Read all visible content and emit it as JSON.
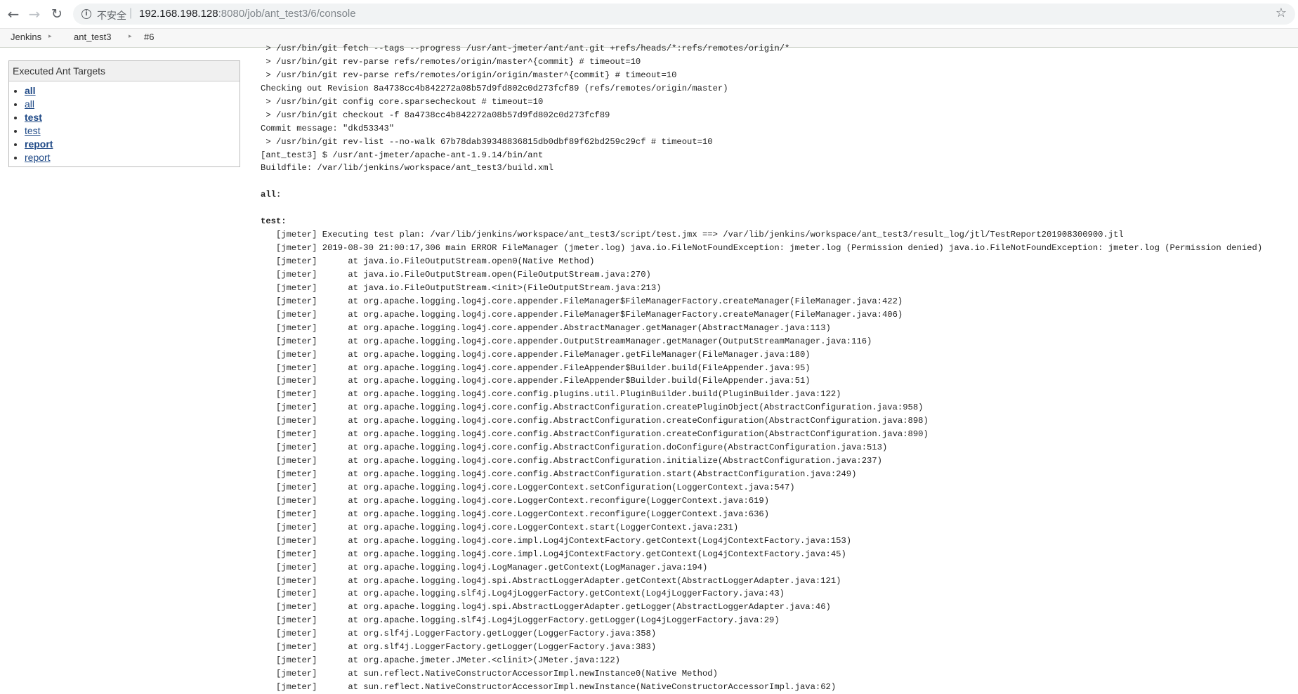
{
  "browser": {
    "back_icon": "←",
    "forward_icon": "→",
    "reload_icon": "↻",
    "info_icon": "i",
    "insecure_label": "不安全",
    "separator": "|",
    "url_host": "192.168.198.128",
    "url_rest": ":8080/job/ant_test3/6/console",
    "star_icon": "☆"
  },
  "breadcrumb": {
    "items": [
      "Jenkins",
      "ant_test3",
      "#6"
    ],
    "separator": "▸"
  },
  "panel": {
    "title": "Executed Ant Targets",
    "items": [
      {
        "label": "all",
        "bold": true
      },
      {
        "label": "all",
        "bold": false
      },
      {
        "label": "test",
        "bold": true
      },
      {
        "label": "test",
        "bold": false
      },
      {
        "label": "report",
        "bold": true
      },
      {
        "label": "report",
        "bold": false
      }
    ]
  },
  "console": {
    "lines": [
      " > /usr/bin/git fetch --tags --progress /usr/ant-jmeter/ant/ant.git +refs/heads/*:refs/remotes/origin/*",
      " > /usr/bin/git rev-parse refs/remotes/origin/master^{commit} # timeout=10",
      " > /usr/bin/git rev-parse refs/remotes/origin/origin/master^{commit} # timeout=10",
      "Checking out Revision 8a4738cc4b842272a08b57d9fd802c0d273fcf89 (refs/remotes/origin/master)",
      " > /usr/bin/git config core.sparsecheckout # timeout=10",
      " > /usr/bin/git checkout -f 8a4738cc4b842272a08b57d9fd802c0d273fcf89",
      "Commit message: \"dkd53343\"",
      " > /usr/bin/git rev-list --no-walk 67b78dab39348836815db0dbf89f62bd259c29cf # timeout=10",
      "[ant_test3] $ /usr/ant-jmeter/apache-ant-1.9.14/bin/ant",
      "Buildfile: /var/lib/jenkins/workspace/ant_test3/build.xml",
      "",
      "all:",
      "",
      "test:",
      "   [jmeter] Executing test plan: /var/lib/jenkins/workspace/ant_test3/script/test.jmx ==> /var/lib/jenkins/workspace/ant_test3/result_log/jtl/TestReport201908300900.jtl",
      "   [jmeter] 2019-08-30 21:00:17,306 main ERROR FileManager (jmeter.log) java.io.FileNotFoundException: jmeter.log (Permission denied) java.io.FileNotFoundException: jmeter.log (Permission denied)",
      "   [jmeter] \tat java.io.FileOutputStream.open0(Native Method)",
      "   [jmeter] \tat java.io.FileOutputStream.open(FileOutputStream.java:270)",
      "   [jmeter] \tat java.io.FileOutputStream.<init>(FileOutputStream.java:213)",
      "   [jmeter] \tat org.apache.logging.log4j.core.appender.FileManager$FileManagerFactory.createManager(FileManager.java:422)",
      "   [jmeter] \tat org.apache.logging.log4j.core.appender.FileManager$FileManagerFactory.createManager(FileManager.java:406)",
      "   [jmeter] \tat org.apache.logging.log4j.core.appender.AbstractManager.getManager(AbstractManager.java:113)",
      "   [jmeter] \tat org.apache.logging.log4j.core.appender.OutputStreamManager.getManager(OutputStreamManager.java:116)",
      "   [jmeter] \tat org.apache.logging.log4j.core.appender.FileManager.getFileManager(FileManager.java:180)",
      "   [jmeter] \tat org.apache.logging.log4j.core.appender.FileAppender$Builder.build(FileAppender.java:95)",
      "   [jmeter] \tat org.apache.logging.log4j.core.appender.FileAppender$Builder.build(FileAppender.java:51)",
      "   [jmeter] \tat org.apache.logging.log4j.core.config.plugins.util.PluginBuilder.build(PluginBuilder.java:122)",
      "   [jmeter] \tat org.apache.logging.log4j.core.config.AbstractConfiguration.createPluginObject(AbstractConfiguration.java:958)",
      "   [jmeter] \tat org.apache.logging.log4j.core.config.AbstractConfiguration.createConfiguration(AbstractConfiguration.java:898)",
      "   [jmeter] \tat org.apache.logging.log4j.core.config.AbstractConfiguration.createConfiguration(AbstractConfiguration.java:890)",
      "   [jmeter] \tat org.apache.logging.log4j.core.config.AbstractConfiguration.doConfigure(AbstractConfiguration.java:513)",
      "   [jmeter] \tat org.apache.logging.log4j.core.config.AbstractConfiguration.initialize(AbstractConfiguration.java:237)",
      "   [jmeter] \tat org.apache.logging.log4j.core.config.AbstractConfiguration.start(AbstractConfiguration.java:249)",
      "   [jmeter] \tat org.apache.logging.log4j.core.LoggerContext.setConfiguration(LoggerContext.java:547)",
      "   [jmeter] \tat org.apache.logging.log4j.core.LoggerContext.reconfigure(LoggerContext.java:619)",
      "   [jmeter] \tat org.apache.logging.log4j.core.LoggerContext.reconfigure(LoggerContext.java:636)",
      "   [jmeter] \tat org.apache.logging.log4j.core.LoggerContext.start(LoggerContext.java:231)",
      "   [jmeter] \tat org.apache.logging.log4j.core.impl.Log4jContextFactory.getContext(Log4jContextFactory.java:153)",
      "   [jmeter] \tat org.apache.logging.log4j.core.impl.Log4jContextFactory.getContext(Log4jContextFactory.java:45)",
      "   [jmeter] \tat org.apache.logging.log4j.LogManager.getContext(LogManager.java:194)",
      "   [jmeter] \tat org.apache.logging.log4j.spi.AbstractLoggerAdapter.getContext(AbstractLoggerAdapter.java:121)",
      "   [jmeter] \tat org.apache.logging.slf4j.Log4jLoggerFactory.getContext(Log4jLoggerFactory.java:43)",
      "   [jmeter] \tat org.apache.logging.log4j.spi.AbstractLoggerAdapter.getLogger(AbstractLoggerAdapter.java:46)",
      "   [jmeter] \tat org.apache.logging.slf4j.Log4jLoggerFactory.getLogger(Log4jLoggerFactory.java:29)",
      "   [jmeter] \tat org.slf4j.LoggerFactory.getLogger(LoggerFactory.java:358)",
      "   [jmeter] \tat org.slf4j.LoggerFactory.getLogger(LoggerFactory.java:383)",
      "   [jmeter] \tat org.apache.jmeter.JMeter.<clinit>(JMeter.java:122)",
      "   [jmeter] \tat sun.reflect.NativeConstructorAccessorImpl.newInstance0(Native Method)",
      "   [jmeter] \tat sun.reflect.NativeConstructorAccessorImpl.newInstance(NativeConstructorAccessorImpl.java:62)"
    ],
    "bold_lines": [
      11,
      13
    ]
  }
}
